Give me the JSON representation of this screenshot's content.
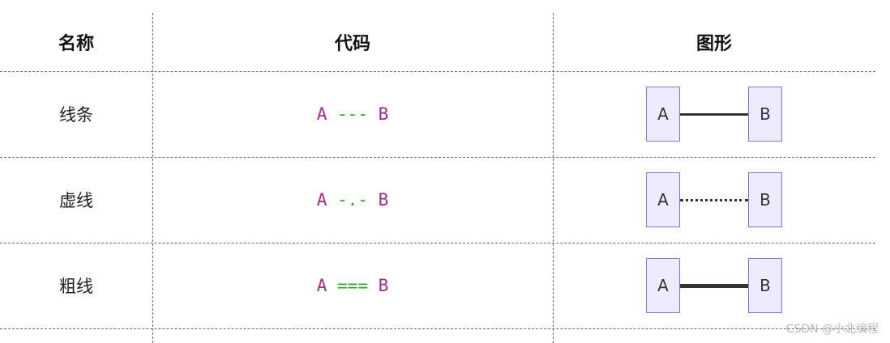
{
  "headers": {
    "name": "名称",
    "code": "代码",
    "figure": "图形"
  },
  "rows": [
    {
      "name": "线条",
      "code": {
        "left": "A",
        "op": "---",
        "right": "B"
      },
      "figure": {
        "left": "A",
        "right": "B",
        "style": "solid"
      }
    },
    {
      "name": "虚线",
      "code": {
        "left": "A",
        "op": "-.-",
        "right": "B"
      },
      "figure": {
        "left": "A",
        "right": "B",
        "style": "dotted"
      }
    },
    {
      "name": "粗线",
      "code": {
        "left": "A",
        "op": "===",
        "right": "B"
      },
      "figure": {
        "left": "A",
        "right": "B",
        "style": "thick"
      }
    }
  ],
  "watermark": "CSDN @小北编程",
  "colors": {
    "node_text": "#9b2f8f",
    "operator_text": "#33a02c",
    "node_fill": "#ececfe",
    "node_border": "#9370db",
    "divider": "#6a6a6a"
  }
}
